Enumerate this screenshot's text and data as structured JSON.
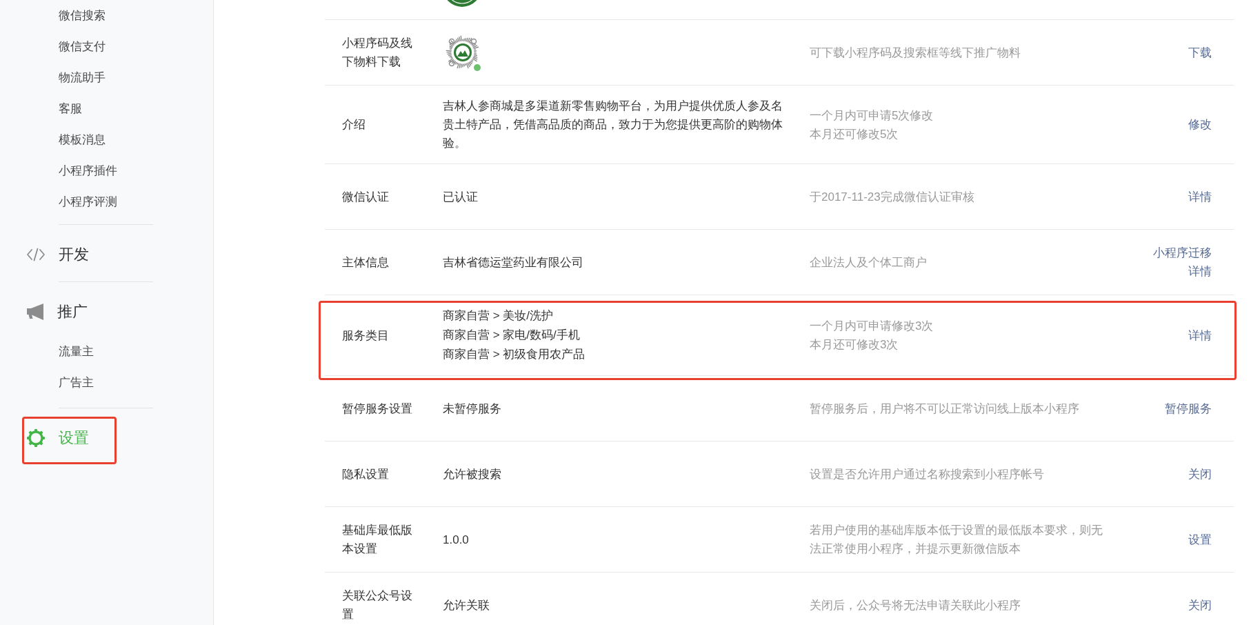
{
  "sidebar": {
    "sections": [
      {
        "highlighted": false,
        "items": [
          {
            "label": "微信搜索",
            "selected": false
          },
          {
            "label": "微信支付",
            "selected": false
          },
          {
            "label": "物流助手",
            "selected": false
          },
          {
            "label": "客服",
            "selected": false
          },
          {
            "label": "模板消息",
            "selected": false
          },
          {
            "label": "小程序插件",
            "selected": false
          },
          {
            "label": "小程序评测",
            "selected": false
          }
        ]
      },
      {
        "title": "开发",
        "selected": false,
        "highlighted": false
      },
      {
        "title": "推广",
        "selected": false,
        "highlighted": false,
        "items": [
          {
            "label": "流量主",
            "selected": false
          },
          {
            "label": "广告主",
            "selected": false
          }
        ]
      },
      {
        "title": "设置",
        "selected": true,
        "highlighted": true
      }
    ]
  },
  "table": {
    "rows": [
      {
        "kind": "logo_cut",
        "highlighted": false
      },
      {
        "kind": "qrcode",
        "label": "小程序码及线下物料下载",
        "description": [
          "可下载小程序码及搜索框等线下推广物料"
        ],
        "actions": [
          "下载"
        ],
        "highlighted": false
      },
      {
        "kind": "text",
        "label": "介绍",
        "value": "吉林人参商城是多渠道新零售购物平台，为用户提供优质人参及名贵土特产品，凭借高品质的商品，致力于为您提供更高阶的购物体验。",
        "description": [
          "一个月内可申请5次修改",
          "本月还可修改5次"
        ],
        "actions": [
          "修改"
        ],
        "highlighted": false
      },
      {
        "kind": "text",
        "label": "微信认证",
        "value": "已认证",
        "description": [
          "于2017-11-23完成微信认证审核"
        ],
        "actions": [
          "详情"
        ],
        "highlighted": false
      },
      {
        "kind": "text",
        "label": "主体信息",
        "value": "吉林省德运堂药业有限公司",
        "description": [
          "企业法人及个体工商户"
        ],
        "actions": [
          "小程序迁移",
          "详情"
        ],
        "highlighted": false
      },
      {
        "kind": "list",
        "label": "服务类目",
        "values": [
          "商家自营 > 美妆/洗护",
          "商家自营 > 家电/数码/手机",
          "商家自营 > 初级食用农产品"
        ],
        "description": [
          "一个月内可申请修改3次",
          "本月还可修改3次"
        ],
        "actions": [
          "详情"
        ],
        "highlighted": true
      },
      {
        "kind": "text",
        "label": "暂停服务设置",
        "value": "未暂停服务",
        "description": [
          "暂停服务后，用户将不可以正常访问线上版本小程序"
        ],
        "actions": [
          "暂停服务"
        ],
        "highlighted": false
      },
      {
        "kind": "text",
        "label": "隐私设置",
        "value": "允许被搜索",
        "description": [
          "设置是否允许用户通过名称搜索到小程序帐号"
        ],
        "actions": [
          "关闭"
        ],
        "highlighted": false
      },
      {
        "kind": "text",
        "label": "基础库最低版本设置",
        "value": "1.0.0",
        "description": [
          "若用户使用的基础库版本低于设置的最低版本要求，则无法正常使用小程序，并提示更新微信版本"
        ],
        "actions": [
          "设置"
        ],
        "highlighted": false
      },
      {
        "kind": "text",
        "label": "关联公众号设置",
        "value": "允许关联",
        "description": [
          "关闭后，公众号将无法申请关联此小程序"
        ],
        "actions": [
          "关闭"
        ],
        "highlighted": false
      }
    ]
  }
}
